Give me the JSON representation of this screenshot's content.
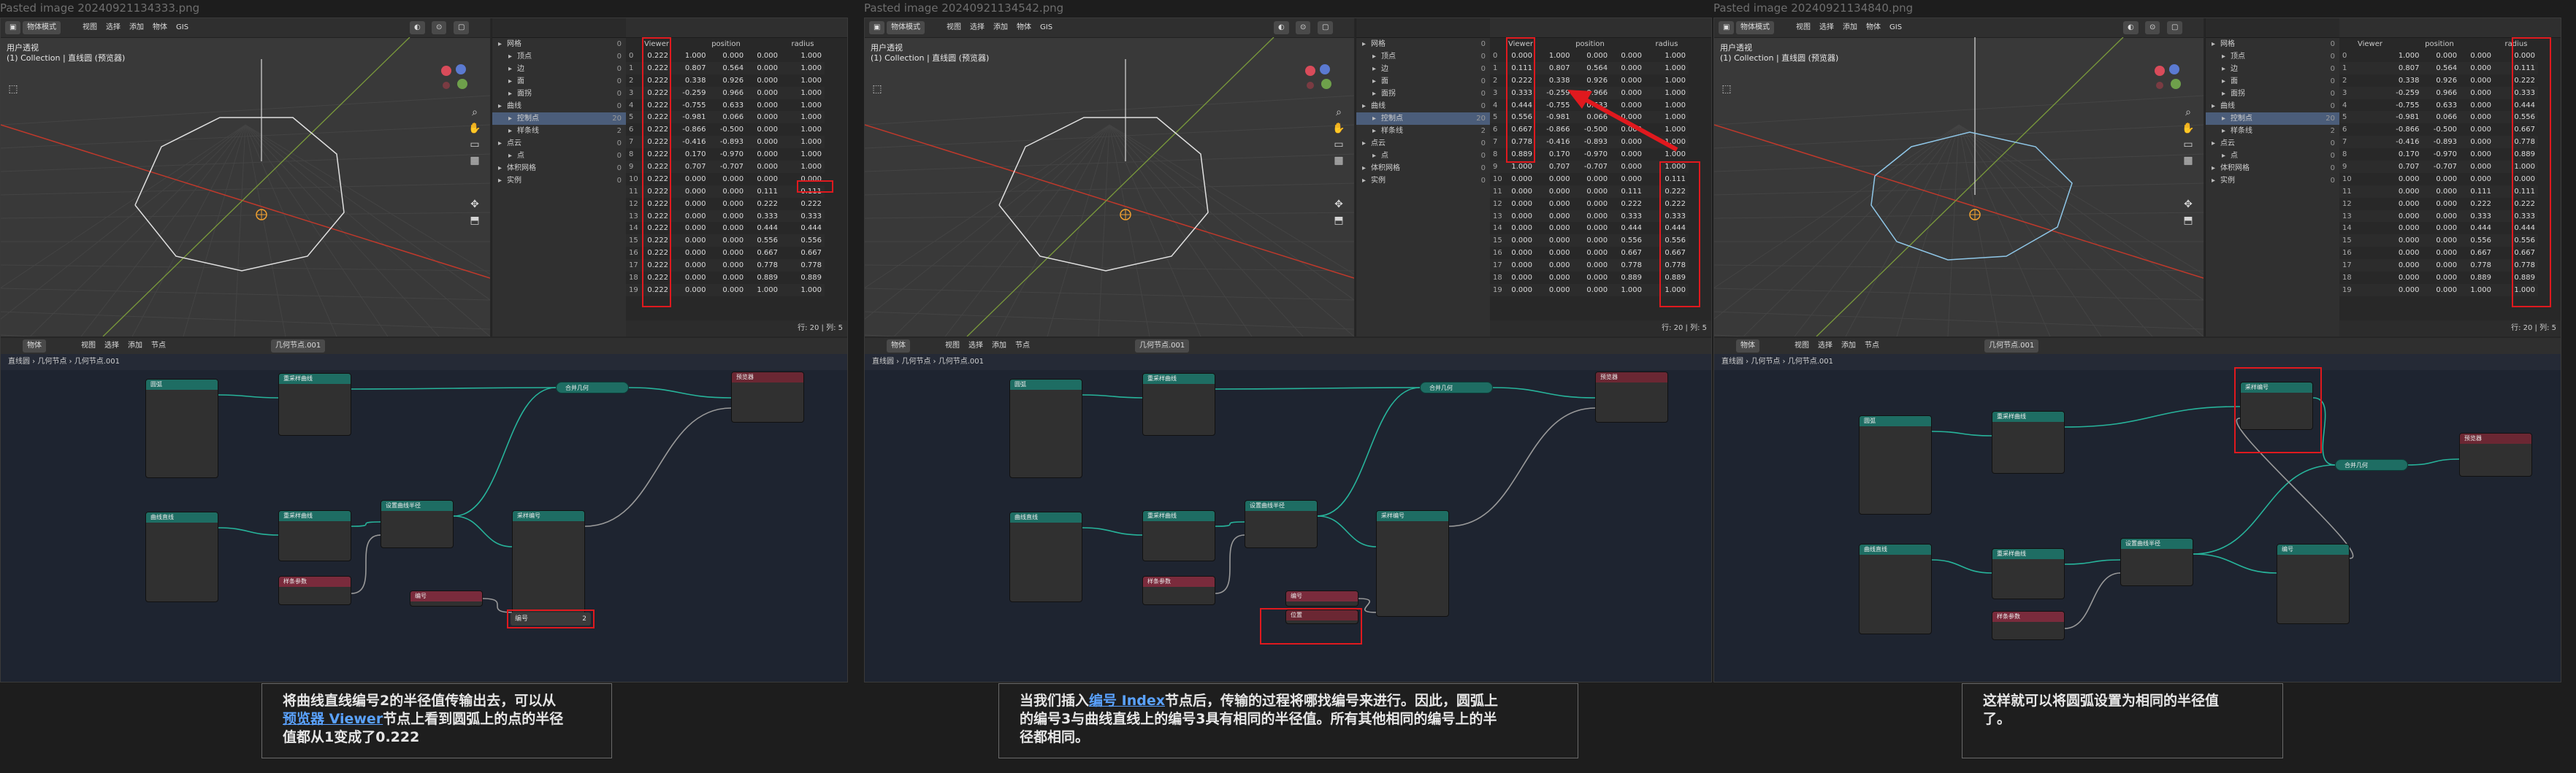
{
  "panels": [
    {
      "title": "Pasted image 20240921134333.png",
      "caption": {
        "line1_a": "将曲线直线编号2的半径值传输出去，可以从",
        "link": "预览器 Viewer",
        "line2_b": "节点上看到圆弧上的点的半径",
        "line3": "值都从1变成了0.222"
      },
      "viewer_col": [
        "0.222",
        "0.222",
        "0.222",
        "0.222",
        "0.222",
        "0.222",
        "0.222",
        "0.222",
        "0.222",
        "0.222",
        "0.222",
        "0.222",
        "0.222",
        "0.222",
        "0.222",
        "0.222",
        "0.222",
        "0.222",
        "0.222",
        "0.222"
      ],
      "radius_col": [
        "1.000",
        "1.000",
        "1.000",
        "1.000",
        "1.000",
        "1.000",
        "1.000",
        "1.000",
        "1.000",
        "1.000",
        "0.000",
        "0.111",
        "0.222",
        "0.333",
        "0.444",
        "0.556",
        "0.667",
        "0.778",
        "0.889",
        "1.000"
      ]
    },
    {
      "title": "Pasted image 20240921134542.png",
      "caption": {
        "line1_a": "当我们插入",
        "link": "编号 Index",
        "line1_b": "节点后，传输的过程将哪找编号来进行。因此，圆弧上",
        "line2": "的编号3与曲线直线上的编号3具有相同的半径值。所有其他相同的编号上的半",
        "line3": "径都相同。"
      },
      "viewer_col": [
        "0.000",
        "0.111",
        "0.222",
        "0.333",
        "0.444",
        "0.556",
        "0.667",
        "0.778",
        "0.889",
        "1.000",
        "0.000",
        "0.000",
        "0.000",
        "0.000",
        "0.000",
        "0.000",
        "0.000",
        "0.000",
        "0.000",
        "0.000"
      ],
      "radius_col": [
        "1.000",
        "1.000",
        "1.000",
        "1.000",
        "1.000",
        "1.000",
        "1.000",
        "1.000",
        "1.000",
        "1.000",
        "0.111",
        "0.222",
        "0.222",
        "0.333",
        "0.444",
        "0.556",
        "0.667",
        "0.778",
        "0.889",
        "1.000"
      ]
    },
    {
      "title": "Pasted image 20240921134840.png",
      "caption": {
        "line1": "这样就可以将圆弧设置为相同的半径值",
        "line2": "了。"
      },
      "viewer_col": [],
      "radius_col": [
        "0.000",
        "0.111",
        "0.222",
        "0.333",
        "0.444",
        "0.556",
        "0.667",
        "0.778",
        "0.889",
        "1.000",
        "0.000",
        "0.111",
        "0.222",
        "0.333",
        "0.444",
        "0.556",
        "0.667",
        "0.778",
        "0.889",
        "1.000"
      ]
    }
  ],
  "sheet": {
    "columns": [
      "Viewer",
      "position",
      "radius"
    ],
    "index": [
      "0",
      "1",
      "2",
      "3",
      "4",
      "5",
      "6",
      "7",
      "8",
      "9",
      "10",
      "11",
      "12",
      "13",
      "14",
      "15",
      "16",
      "17",
      "18",
      "19"
    ],
    "pos_x": [
      "1.000",
      "0.807",
      "0.338",
      "-0.259",
      "-0.755",
      "-0.981",
      "-0.866",
      "-0.416",
      "0.170",
      "0.707",
      "0.000",
      "0.000",
      "0.000",
      "0.000",
      "0.000",
      "0.000",
      "0.000",
      "0.000",
      "0.000",
      "0.000"
    ],
    "pos_y": [
      "0.000",
      "0.564",
      "0.926",
      "0.966",
      "0.633",
      "0.066",
      "-0.500",
      "-0.893",
      "-0.970",
      "-0.707",
      "0.000",
      "0.000",
      "0.000",
      "0.000",
      "0.000",
      "0.000",
      "0.000",
      "0.000",
      "0.000",
      "0.000"
    ],
    "pos_z": [
      "0.000",
      "0.000",
      "0.000",
      "0.000",
      "0.000",
      "0.000",
      "0.000",
      "0.000",
      "0.000",
      "0.000",
      "0.000",
      "0.111",
      "0.222",
      "0.333",
      "0.444",
      "0.556",
      "0.667",
      "0.778",
      "0.889",
      "1.000"
    ],
    "footer": "行: 20 | 列: 5"
  },
  "outliner": {
    "items": [
      {
        "label": "网格",
        "num": "0"
      },
      {
        "label": "顶点",
        "num": "0"
      },
      {
        "label": "边",
        "num": "0"
      },
      {
        "label": "面",
        "num": "0"
      },
      {
        "label": "面拐",
        "num": "0"
      },
      {
        "label": "曲线",
        "num": "0"
      },
      {
        "label": "控制点",
        "num": "20"
      },
      {
        "label": "样条线",
        "num": "2"
      },
      {
        "label": "点云",
        "num": "0"
      },
      {
        "label": "点",
        "num": "0"
      },
      {
        "label": "体积网格",
        "num": "0"
      },
      {
        "label": "实例",
        "num": "0"
      }
    ]
  },
  "viewport": {
    "mode": "物体模式",
    "menus": [
      "视图",
      "选择",
      "添加",
      "物体",
      "GIS"
    ],
    "view_label": "用户透视",
    "collection_label": "(1) Collection | 直线圆 (预览器)"
  },
  "node_editor": {
    "menus": [
      "视图",
      "选择",
      "添加",
      "节点"
    ],
    "editor": "物体",
    "breadcrumb": "直线圆 › 几何节点 › 几何节点.001",
    "tree_name": "几何节点.001",
    "nodes": {
      "arc": "圆弧",
      "curve_line": "曲线直线",
      "resample1": "重采样曲线",
      "resample2": "重采样曲线",
      "set_radius": "设置曲线半径",
      "transfer": "采样编号",
      "join": "合并几何",
      "viewer": "预览器",
      "index": "编号",
      "param": "样条参数",
      "position": "位置"
    },
    "index_label": "编号",
    "index_value": "2"
  }
}
